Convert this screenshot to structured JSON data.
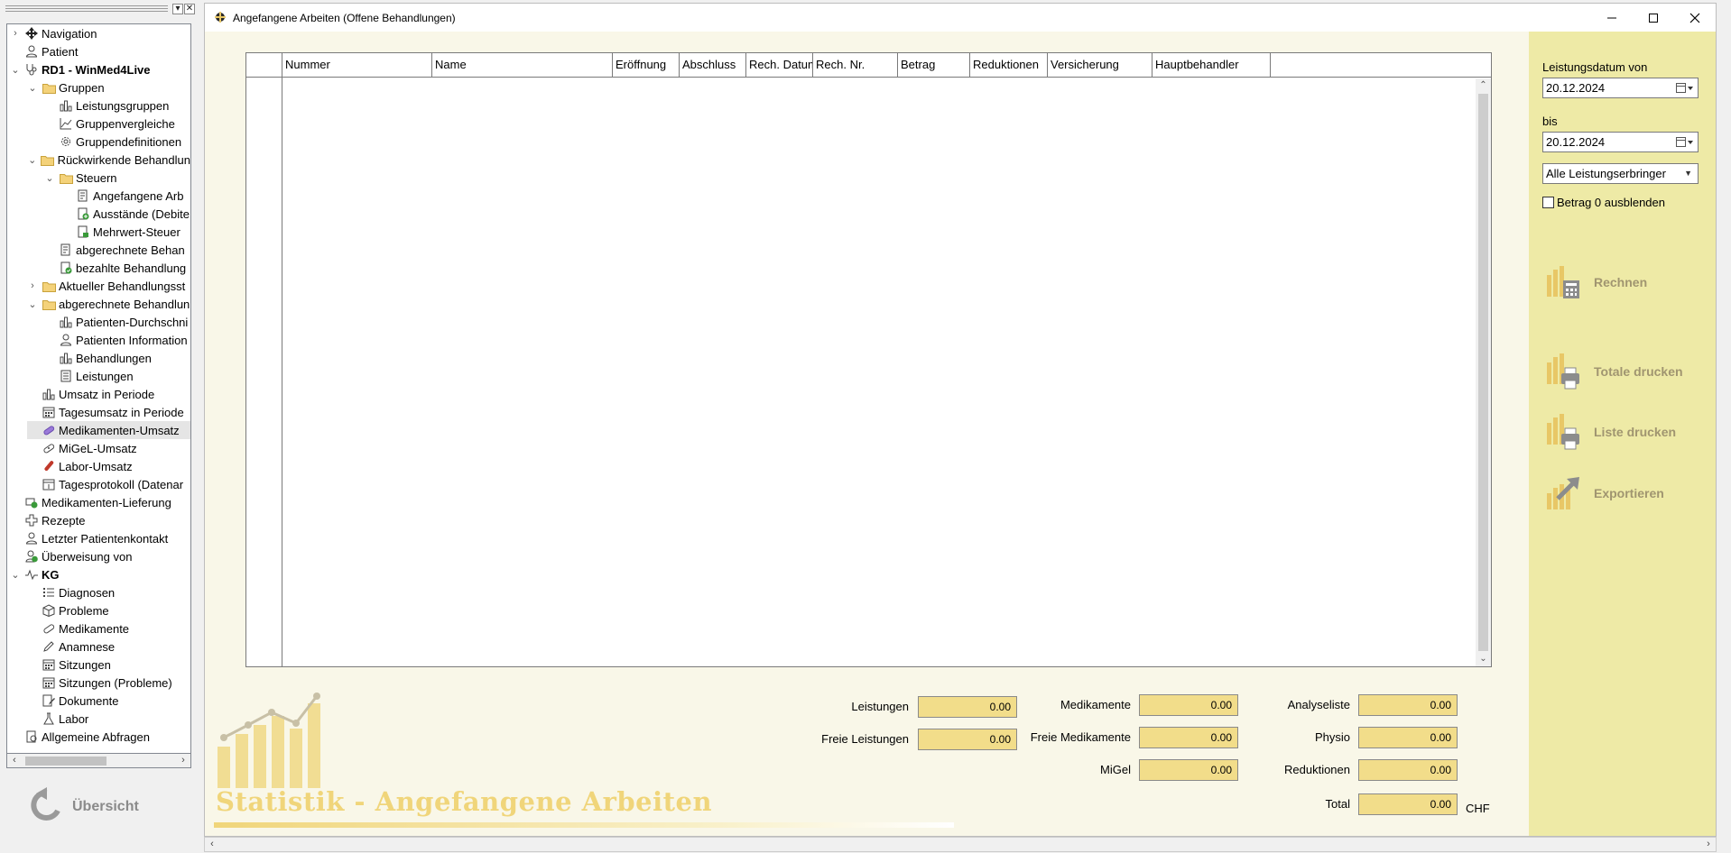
{
  "nav": {
    "items": [
      {
        "label": "Navigation",
        "icon": "navigation-icon",
        "indent": 0,
        "expander": "collapsed"
      },
      {
        "label": "Patient",
        "icon": "person-icon",
        "indent": 0,
        "expander": "none"
      },
      {
        "label": "RD1 - WinMed4Live",
        "icon": "stethoscope-icon",
        "indent": 0,
        "expander": "expanded",
        "bold": true
      },
      {
        "label": "Gruppen",
        "icon": "folder-icon",
        "indent": 1,
        "expander": "expanded"
      },
      {
        "label": "Leistungsgruppen",
        "icon": "bar-chart-icon",
        "indent": 2,
        "expander": "none"
      },
      {
        "label": "Gruppenvergleiche",
        "icon": "line-chart-icon",
        "indent": 2,
        "expander": "none"
      },
      {
        "label": "Gruppendefinitionen",
        "icon": "gear-icon",
        "indent": 2,
        "expander": "none"
      },
      {
        "label": "Rückwirkende Behandlun",
        "icon": "folder-icon",
        "indent": 1,
        "expander": "expanded"
      },
      {
        "label": "Steuern",
        "icon": "folder-icon",
        "indent": 2,
        "expander": "expanded"
      },
      {
        "label": "Angefangene Arb",
        "icon": "report-icon",
        "indent": 3,
        "expander": "none"
      },
      {
        "label": "Ausstände (Debite",
        "icon": "report-add-icon",
        "indent": 3,
        "expander": "none"
      },
      {
        "label": "Mehrwert-Steuer",
        "icon": "report-green-icon",
        "indent": 3,
        "expander": "none"
      },
      {
        "label": "abgerechnete Behan",
        "icon": "report-icon",
        "indent": 2,
        "expander": "none"
      },
      {
        "label": "bezahlte Behandlung",
        "icon": "report-check-icon",
        "indent": 2,
        "expander": "none"
      },
      {
        "label": "Aktueller Behandlungsst",
        "icon": "folder-icon",
        "indent": 1,
        "expander": "collapsed"
      },
      {
        "label": "abgerechnete Behandlun",
        "icon": "folder-icon",
        "indent": 1,
        "expander": "expanded"
      },
      {
        "label": "Patienten-Durchschni",
        "icon": "bar-chart-icon",
        "indent": 2,
        "expander": "none"
      },
      {
        "label": "Patienten Information",
        "icon": "person-icon",
        "indent": 2,
        "expander": "none"
      },
      {
        "label": "Behandlungen",
        "icon": "bar-chart-icon",
        "indent": 2,
        "expander": "none"
      },
      {
        "label": "Leistungen",
        "icon": "document-icon",
        "indent": 2,
        "expander": "none"
      },
      {
        "label": "Umsatz in Periode",
        "icon": "bar-chart-icon",
        "indent": 1,
        "expander": "none"
      },
      {
        "label": "Tagesumsatz in Periode",
        "icon": "calendar-icon",
        "indent": 1,
        "expander": "none"
      },
      {
        "label": "Medikamenten-Umsatz",
        "icon": "pill-icon",
        "indent": 1,
        "expander": "none",
        "selected": true
      },
      {
        "label": "MiGeL-Umsatz",
        "icon": "bandage-icon",
        "indent": 1,
        "expander": "none"
      },
      {
        "label": "Labor-Umsatz",
        "icon": "test-tube-icon",
        "indent": 1,
        "expander": "none"
      },
      {
        "label": "Tagesprotokoll (Datenar",
        "icon": "calendar-day-icon",
        "indent": 1,
        "expander": "none"
      },
      {
        "label": "Medikamenten-Lieferung",
        "icon": "delivery-icon",
        "indent": 0,
        "expander": "none"
      },
      {
        "label": "Rezepte",
        "icon": "cross-icon",
        "indent": 0,
        "expander": "none"
      },
      {
        "label": "Letzter Patientenkontakt",
        "icon": "person-icon",
        "indent": 0,
        "expander": "none"
      },
      {
        "label": "Überweisung von",
        "icon": "referral-icon",
        "indent": 0,
        "expander": "none"
      },
      {
        "label": "KG",
        "icon": "heartbeat-icon",
        "indent": 0,
        "expander": "expanded",
        "bold": true
      },
      {
        "label": "Diagnosen",
        "icon": "list-icon",
        "indent": 1,
        "expander": "none"
      },
      {
        "label": "Probleme",
        "icon": "cube-icon",
        "indent": 1,
        "expander": "none"
      },
      {
        "label": "Medikamente",
        "icon": "pill-outline-icon",
        "indent": 1,
        "expander": "none"
      },
      {
        "label": "Anamnese",
        "icon": "pencil-icon",
        "indent": 1,
        "expander": "none"
      },
      {
        "label": "Sitzungen",
        "icon": "calendar-icon",
        "indent": 1,
        "expander": "none"
      },
      {
        "label": "Sitzungen (Probleme)",
        "icon": "calendar-icon",
        "indent": 1,
        "expander": "none"
      },
      {
        "label": "Dokumente",
        "icon": "document-edit-icon",
        "indent": 1,
        "expander": "none"
      },
      {
        "label": "Labor",
        "icon": "flask-icon",
        "indent": 1,
        "expander": "none"
      },
      {
        "label": "Allgemeine Abfragen",
        "icon": "query-icon",
        "indent": 0,
        "expander": "none"
      }
    ],
    "overview_label": "Übersicht"
  },
  "window": {
    "title": "Angefangene Arbeiten (Offene Behandlungen)",
    "minimize": "—",
    "maximize": "☐",
    "close": "✕"
  },
  "grid": {
    "columns": [
      "Nummer",
      "Name",
      "Eröffnung",
      "Abschluss",
      "Rech. Datum",
      "Rech. Nr.",
      "Betrag",
      "Reduktionen",
      "Versicherung",
      "Hauptbehandler",
      ""
    ],
    "rows": []
  },
  "totals": {
    "col1": [
      {
        "label": "Leistungen",
        "value": "0.00"
      },
      {
        "label": "Freie Leistungen",
        "value": "0.00"
      }
    ],
    "col2": [
      {
        "label": "Medikamente",
        "value": "0.00"
      },
      {
        "label": "Freie Medikamente",
        "value": "0.00"
      },
      {
        "label": "MiGel",
        "value": "0.00"
      }
    ],
    "col3": [
      {
        "label": "Analyseliste",
        "value": "0.00"
      },
      {
        "label": "Physio",
        "value": "0.00"
      },
      {
        "label": "Reduktionen",
        "value": "0.00"
      },
      {
        "label": "Total",
        "value": "0.00"
      }
    ],
    "currency": "CHF"
  },
  "watermark": {
    "title": "Statistik - Angefangene Arbeiten"
  },
  "panel": {
    "date_from_label": "Leistungsdatum von",
    "date_from": "20.12.2024",
    "date_to_label": "bis",
    "date_to": "20.12.2024",
    "provider": "Alle Leistungserbringer",
    "hide_zero_label": "Betrag 0 ausblenden",
    "hide_zero_checked": false,
    "actions": [
      {
        "label": "Rechnen",
        "icon": "calculate-icon"
      },
      {
        "label": "Totale drucken",
        "icon": "print-totals-icon"
      },
      {
        "label": "Liste drucken",
        "icon": "print-list-icon"
      },
      {
        "label": "Exportieren",
        "icon": "export-icon"
      }
    ]
  },
  "colors": {
    "accent_gold": "#e8c766",
    "field_yellow": "#f2dd8a",
    "panel_bg": "#eeeaa6",
    "window_bg": "#f9f7e8"
  }
}
